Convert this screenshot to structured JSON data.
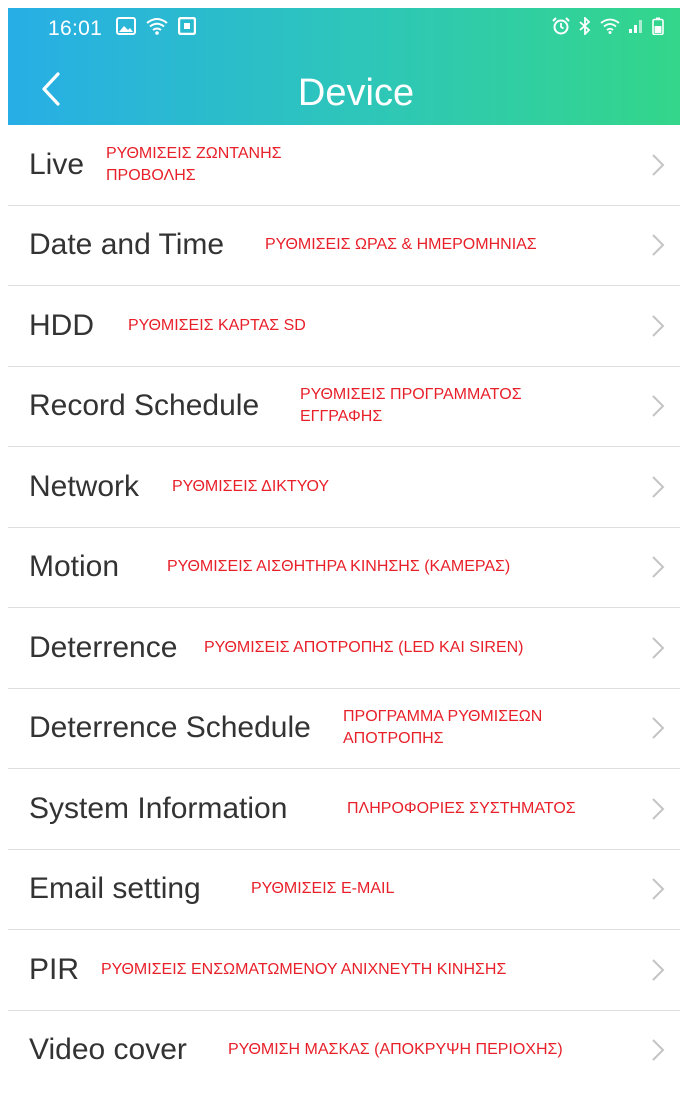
{
  "status_bar": {
    "time": "16:01",
    "left_icons": [
      "gallery-icon",
      "wifi-icon",
      "screenshot-icon"
    ],
    "right_icons": [
      "alarm-icon",
      "bluetooth-icon",
      "wifi-icon",
      "signal-icon",
      "battery-icon"
    ]
  },
  "header": {
    "title": "Device",
    "back_icon": "chevron-left-icon",
    "gradient": [
      "#27aee6",
      "#33d68a"
    ]
  },
  "colors": {
    "annotation": "#e8202a",
    "label": "#333333",
    "chevron": "#c4c4c4",
    "divider": "#dedede"
  },
  "menu": [
    {
      "label": "Live",
      "note": "ΡΥΘΜΙΣΕΙΣ ΖΩΝΤΑΝΗΣ ΠΡΟΒΟΛΗΣ"
    },
    {
      "label": "Date and Time",
      "note": "ΡΥΘΜΙΣΕΙΣ ΩΡΑΣ & ΗΜΕΡΟΜΗΝΙΑΣ"
    },
    {
      "label": "HDD",
      "note": "ΡΥΘΜΙΣΕΙΣ ΚΑΡΤΑΣ SD"
    },
    {
      "label": "Record Schedule",
      "note": "ΡΥΘΜΙΣΕΙΣ ΠΡΟΓΡΑΜΜΑΤΟΣ ΕΓΓΡΑΦΗΣ"
    },
    {
      "label": "Network",
      "note": "ΡΥΘΜΙΣΕΙΣ ΔΙΚΤΥΟΥ"
    },
    {
      "label": "Motion",
      "note": "ΡΥΘΜΙΣΕΙΣ ΑΙΣΘΗΤΗΡΑ ΚΙΝΗΣΗΣ (ΚΑΜΕΡΑΣ)"
    },
    {
      "label": "Deterrence",
      "note": "ΡΥΘΜΙΣΕΙΣ ΑΠΟΤΡΟΠΗΣ (LED ΚΑΙ SIREN)"
    },
    {
      "label": "Deterrence Schedule",
      "note": "ΠΡΟΓΡΑΜΜΑ ΡΥΘΜΙΣΕΩΝ ΑΠΟΤΡΟΠΗΣ"
    },
    {
      "label": "System Information",
      "note": "ΠΛΗΡΟΦΟΡΙΕΣ ΣΥΣΤΗΜΑΤΟΣ"
    },
    {
      "label": "Email setting",
      "note": "ΡΥΘΜΙΣΕΙΣ E-MAIL"
    },
    {
      "label": "PIR",
      "note": "ΡΥΘΜΙΣΕΙΣ ΕΝΣΩΜΑΤΩΜΕΝΟΥ ΑΝΙΧΝΕΥΤΗ ΚΙΝΗΣΗΣ"
    },
    {
      "label": "Video cover",
      "note": "ΡΥΘΜΙΣΗ ΜΑΣΚΑΣ (ΑΠΟΚΡΥΨΗ ΠΕΡΙΟΧΗΣ)"
    }
  ]
}
